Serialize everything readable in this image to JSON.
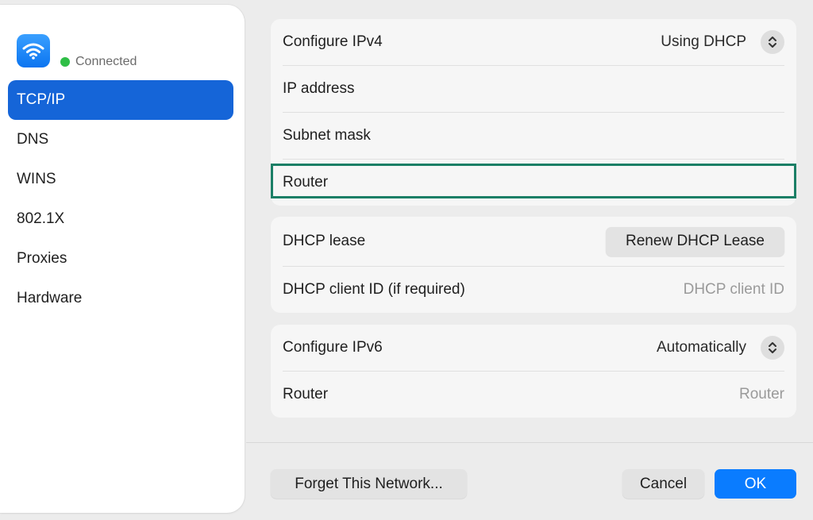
{
  "sidebar": {
    "network_icon": "wifi-icon",
    "status": {
      "text": "Connected",
      "color": "#2fbe46"
    },
    "items": [
      {
        "label": "TCP/IP",
        "active": true
      },
      {
        "label": "DNS"
      },
      {
        "label": "WINS"
      },
      {
        "label": "802.1X"
      },
      {
        "label": "Proxies"
      },
      {
        "label": "Hardware"
      }
    ],
    "accent": "#1565d8"
  },
  "ipv4": {
    "configure_label": "Configure IPv4",
    "configure_value": "Using DHCP",
    "ip_label": "IP address",
    "subnet_label": "Subnet mask",
    "router_label": "Router"
  },
  "dhcp": {
    "lease_label": "DHCP lease",
    "renew_button": "Renew DHCP Lease",
    "client_id_label": "DHCP client ID (if required)",
    "client_id_placeholder": "DHCP client ID"
  },
  "ipv6": {
    "configure_label": "Configure IPv6",
    "configure_value": "Automatically",
    "router_label": "Router",
    "router_placeholder": "Router"
  },
  "footer": {
    "forget_button": "Forget This Network...",
    "cancel_button": "Cancel",
    "ok_button": "OK",
    "ok_color": "#0a7cff"
  },
  "highlight_color": "#1b7f66"
}
